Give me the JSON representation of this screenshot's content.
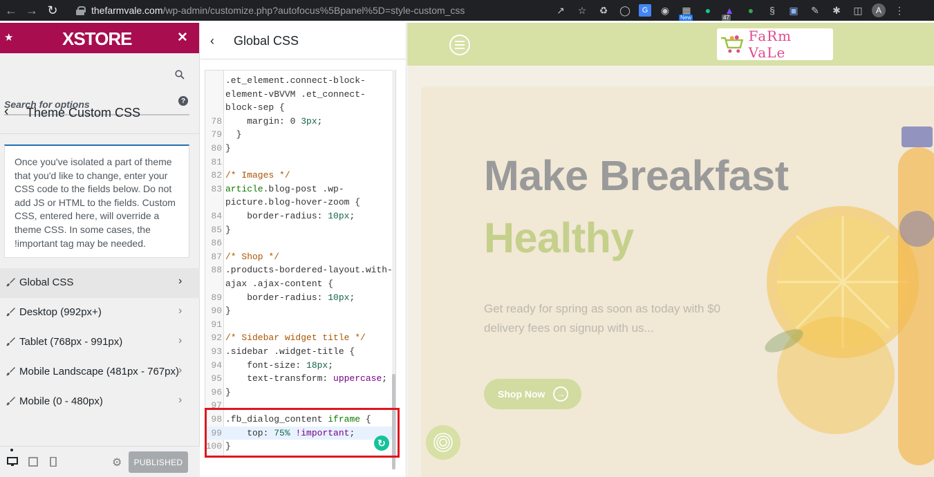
{
  "browser": {
    "url_host": "thefarmvale.com",
    "url_path": "/wp-admin/customize.php?autofocus%5Bpanel%5D=style-custom_css",
    "ext_badge_new": "New",
    "ext_badge_count": "47",
    "avatar_letter": "A"
  },
  "sidebar": {
    "brand": "XSTORE",
    "search_placeholder": "Search for options",
    "section_title": "Theme Custom CSS",
    "description": "Once you've isolated a part of theme that you'd like to change, enter your CSS code to the fields below. Do not add JS or HTML to the fields. Custom CSS, entered here, will override a theme CSS. In some cases, the !important tag may be needed.",
    "items": [
      {
        "label": "Global CSS"
      },
      {
        "label": "Desktop (992px+)"
      },
      {
        "label": "Tablet (768px - 991px)"
      },
      {
        "label": "Mobile Landscape (481px - 767px)"
      },
      {
        "label": "Mobile (0 - 480px)"
      }
    ],
    "publish_label": "PUBLISHED"
  },
  "editor": {
    "title": "Global CSS",
    "lines": [
      {
        "n": "",
        "t": ".et_element.connect-block-"
      },
      {
        "n": "",
        "t": "element-vBVVM .et_connect-"
      },
      {
        "n": "",
        "t": "block-sep {"
      },
      {
        "n": "78",
        "t": "    margin: 0 3px;"
      },
      {
        "n": "79",
        "t": "  }"
      },
      {
        "n": "80",
        "t": "}"
      },
      {
        "n": "81",
        "t": ""
      },
      {
        "n": "82",
        "t": "/* Images */"
      },
      {
        "n": "83",
        "t": "article.blog-post .wp-"
      },
      {
        "n": "",
        "t": "picture.blog-hover-zoom {"
      },
      {
        "n": "84",
        "t": "    border-radius: 10px;"
      },
      {
        "n": "85",
        "t": "}"
      },
      {
        "n": "86",
        "t": ""
      },
      {
        "n": "87",
        "t": "/* Shop */"
      },
      {
        "n": "88",
        "t": ".products-bordered-layout.with-"
      },
      {
        "n": "",
        "t": "ajax .ajax-content {"
      },
      {
        "n": "89",
        "t": "    border-radius: 10px;"
      },
      {
        "n": "90",
        "t": "}"
      },
      {
        "n": "91",
        "t": ""
      },
      {
        "n": "92",
        "t": "/* Sidebar widget title */"
      },
      {
        "n": "93",
        "t": ".sidebar .widget-title {"
      },
      {
        "n": "94",
        "t": "    font-size: 18px;"
      },
      {
        "n": "95",
        "t": "    text-transform: uppercase;"
      },
      {
        "n": "96",
        "t": "}"
      },
      {
        "n": "97",
        "t": ""
      },
      {
        "n": "98",
        "t": ".fb_dialog_content iframe {"
      },
      {
        "n": "99",
        "t": "    top: 75% !important;"
      },
      {
        "n": "100",
        "t": "}"
      }
    ]
  },
  "preview": {
    "logo_text": "FaRm VaLe",
    "hero_line1": "Make Breakfast",
    "hero_line2": "Healthy",
    "hero_desc": "Get ready for spring as soon as today with $0 delivery fees on signup with us...",
    "shop_button": "Shop Now"
  },
  "colors": {
    "brand": "#a80d50",
    "highlight_box": "#e0161e",
    "site_header": "#d7e0a5",
    "accent_green": "#c5d08b"
  }
}
